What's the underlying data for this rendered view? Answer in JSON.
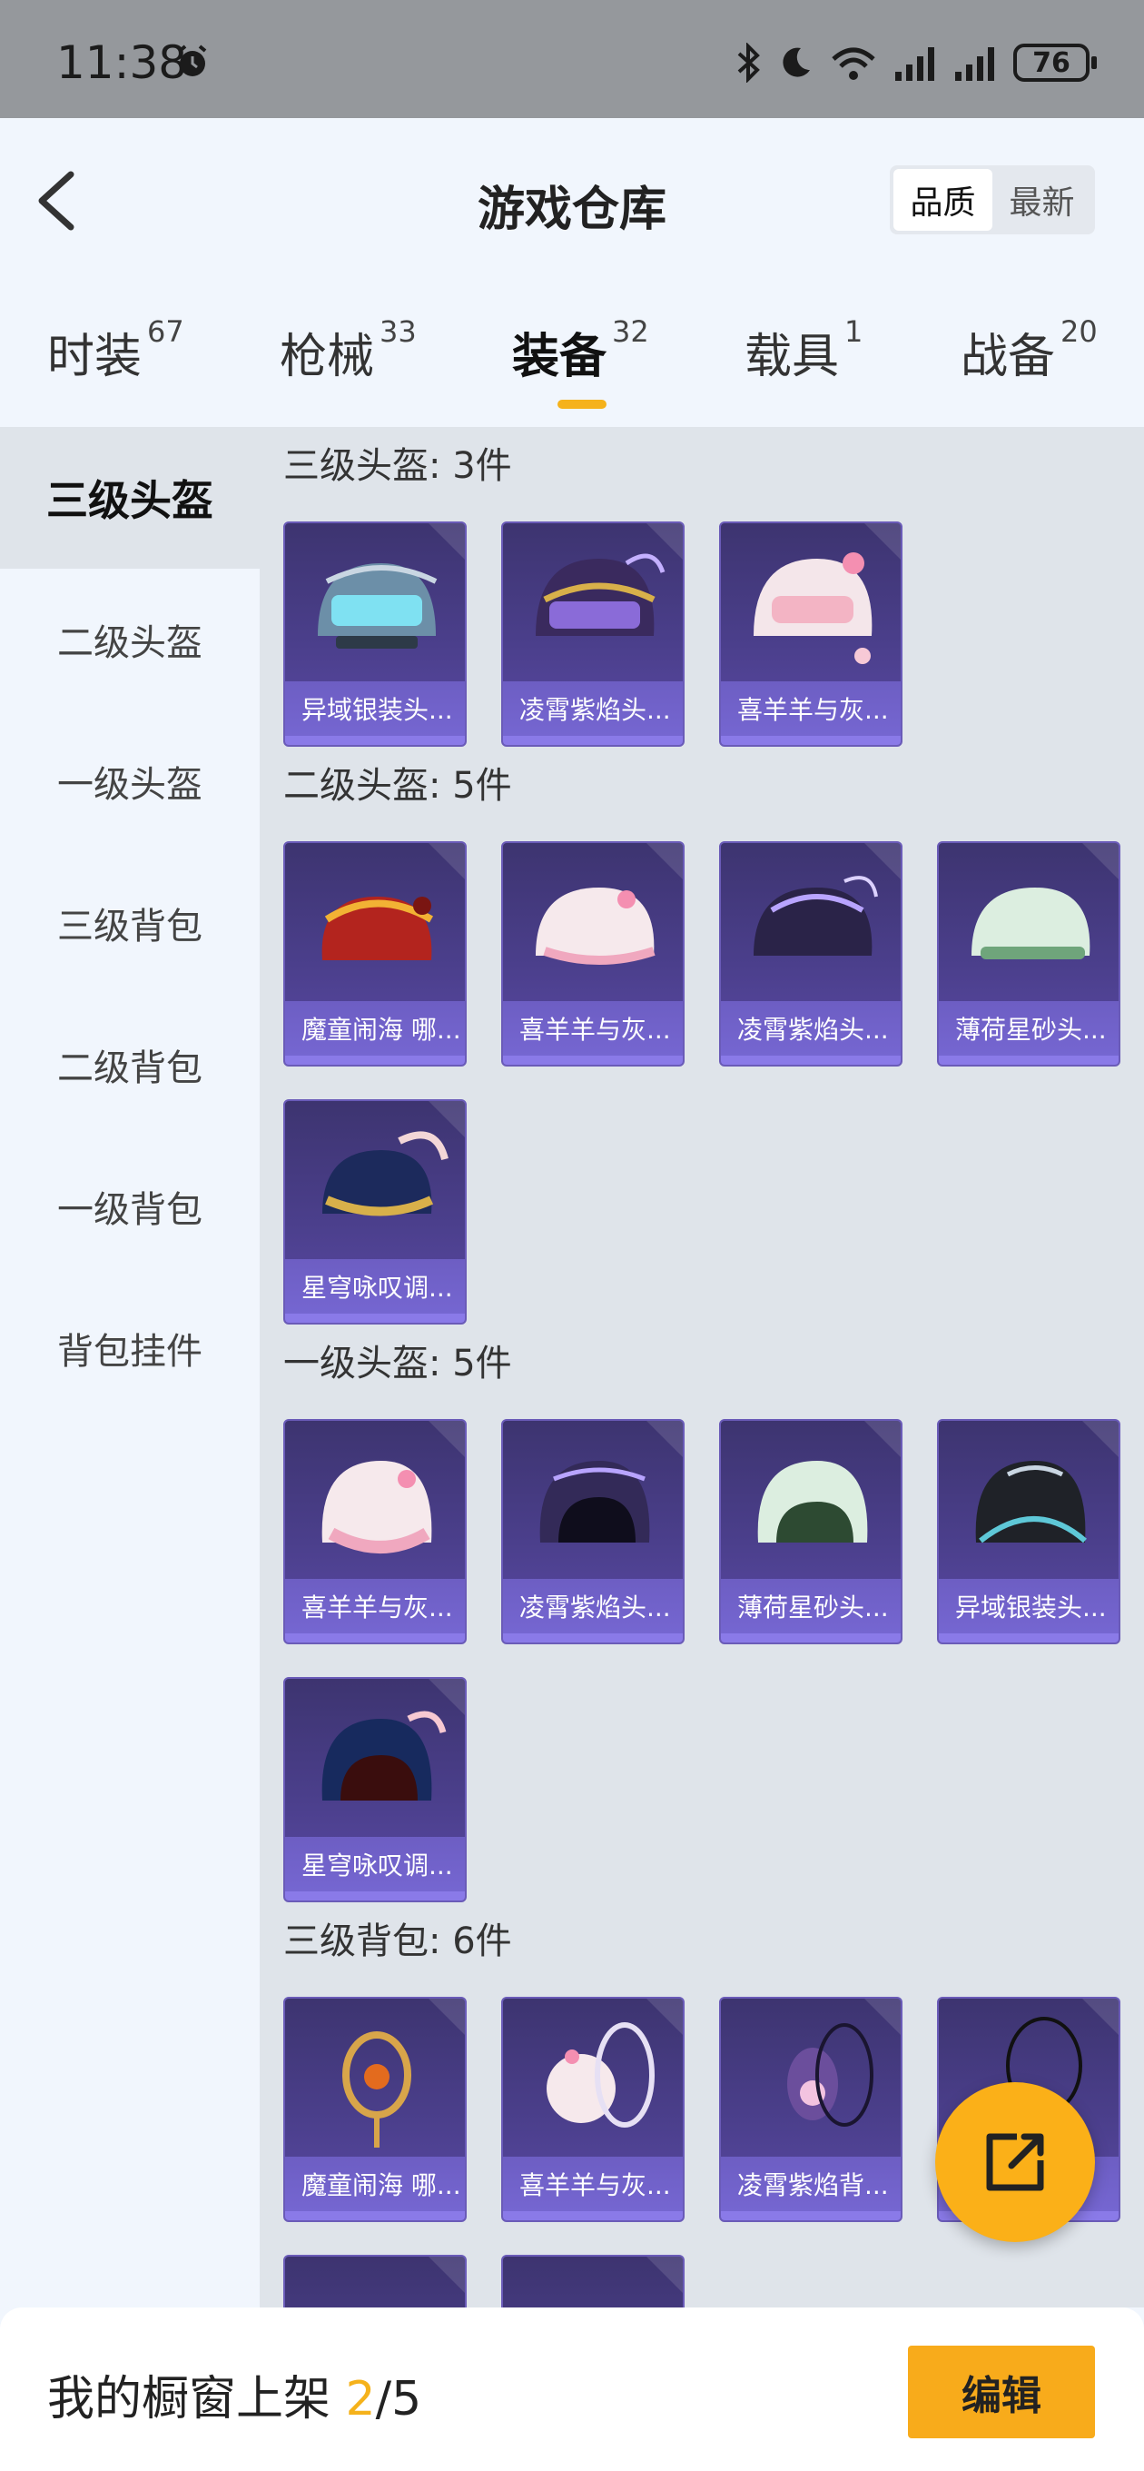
{
  "status": {
    "time": "11:38",
    "battery": "76"
  },
  "header": {
    "title": "游戏仓库",
    "sort_options": [
      "品质",
      "最新"
    ]
  },
  "tabs": [
    {
      "label": "时装",
      "count": "67"
    },
    {
      "label": "枪械",
      "count": "33"
    },
    {
      "label": "装备",
      "count": "32"
    },
    {
      "label": "载具",
      "count": "1"
    },
    {
      "label": "战备",
      "count": "20"
    }
  ],
  "sidebar": [
    "三级头盔",
    "二级头盔",
    "一级头盔",
    "三级背包",
    "二级背包",
    "一级背包",
    "背包挂件"
  ],
  "sections": [
    {
      "title": "三级头盔: 3件",
      "items": [
        "异域银装头...",
        "凌霄紫焰头...",
        "喜羊羊与灰..."
      ]
    },
    {
      "title": "二级头盔: 5件",
      "items": [
        "魔童闹海 哪...",
        "喜羊羊与灰...",
        "凌霄紫焰头...",
        "薄荷星砂头...",
        "星穹咏叹调..."
      ]
    },
    {
      "title": "一级头盔: 5件",
      "items": [
        "喜羊羊与灰...",
        "凌霄紫焰头...",
        "薄荷星砂头...",
        "异域银装头...",
        "星穹咏叹调..."
      ]
    },
    {
      "title": "三级背包: 6件",
      "items": [
        "魔童闹海 哪...",
        "喜羊羊与灰...",
        "凌霄紫焰背...",
        "",
        "",
        ""
      ]
    }
  ],
  "bottom": {
    "shelf_prefix": "我的橱窗上架 ",
    "shelf_count": "2",
    "shelf_total": "/5",
    "edit_label": "编辑"
  },
  "colors": {
    "accent": "#f5b21b",
    "card_bg": "#4b3f8c",
    "card_label": "#7566d1"
  },
  "icons": {
    "back": "chevron-left-icon",
    "share": "share-icon",
    "alarm": "alarm-icon"
  }
}
